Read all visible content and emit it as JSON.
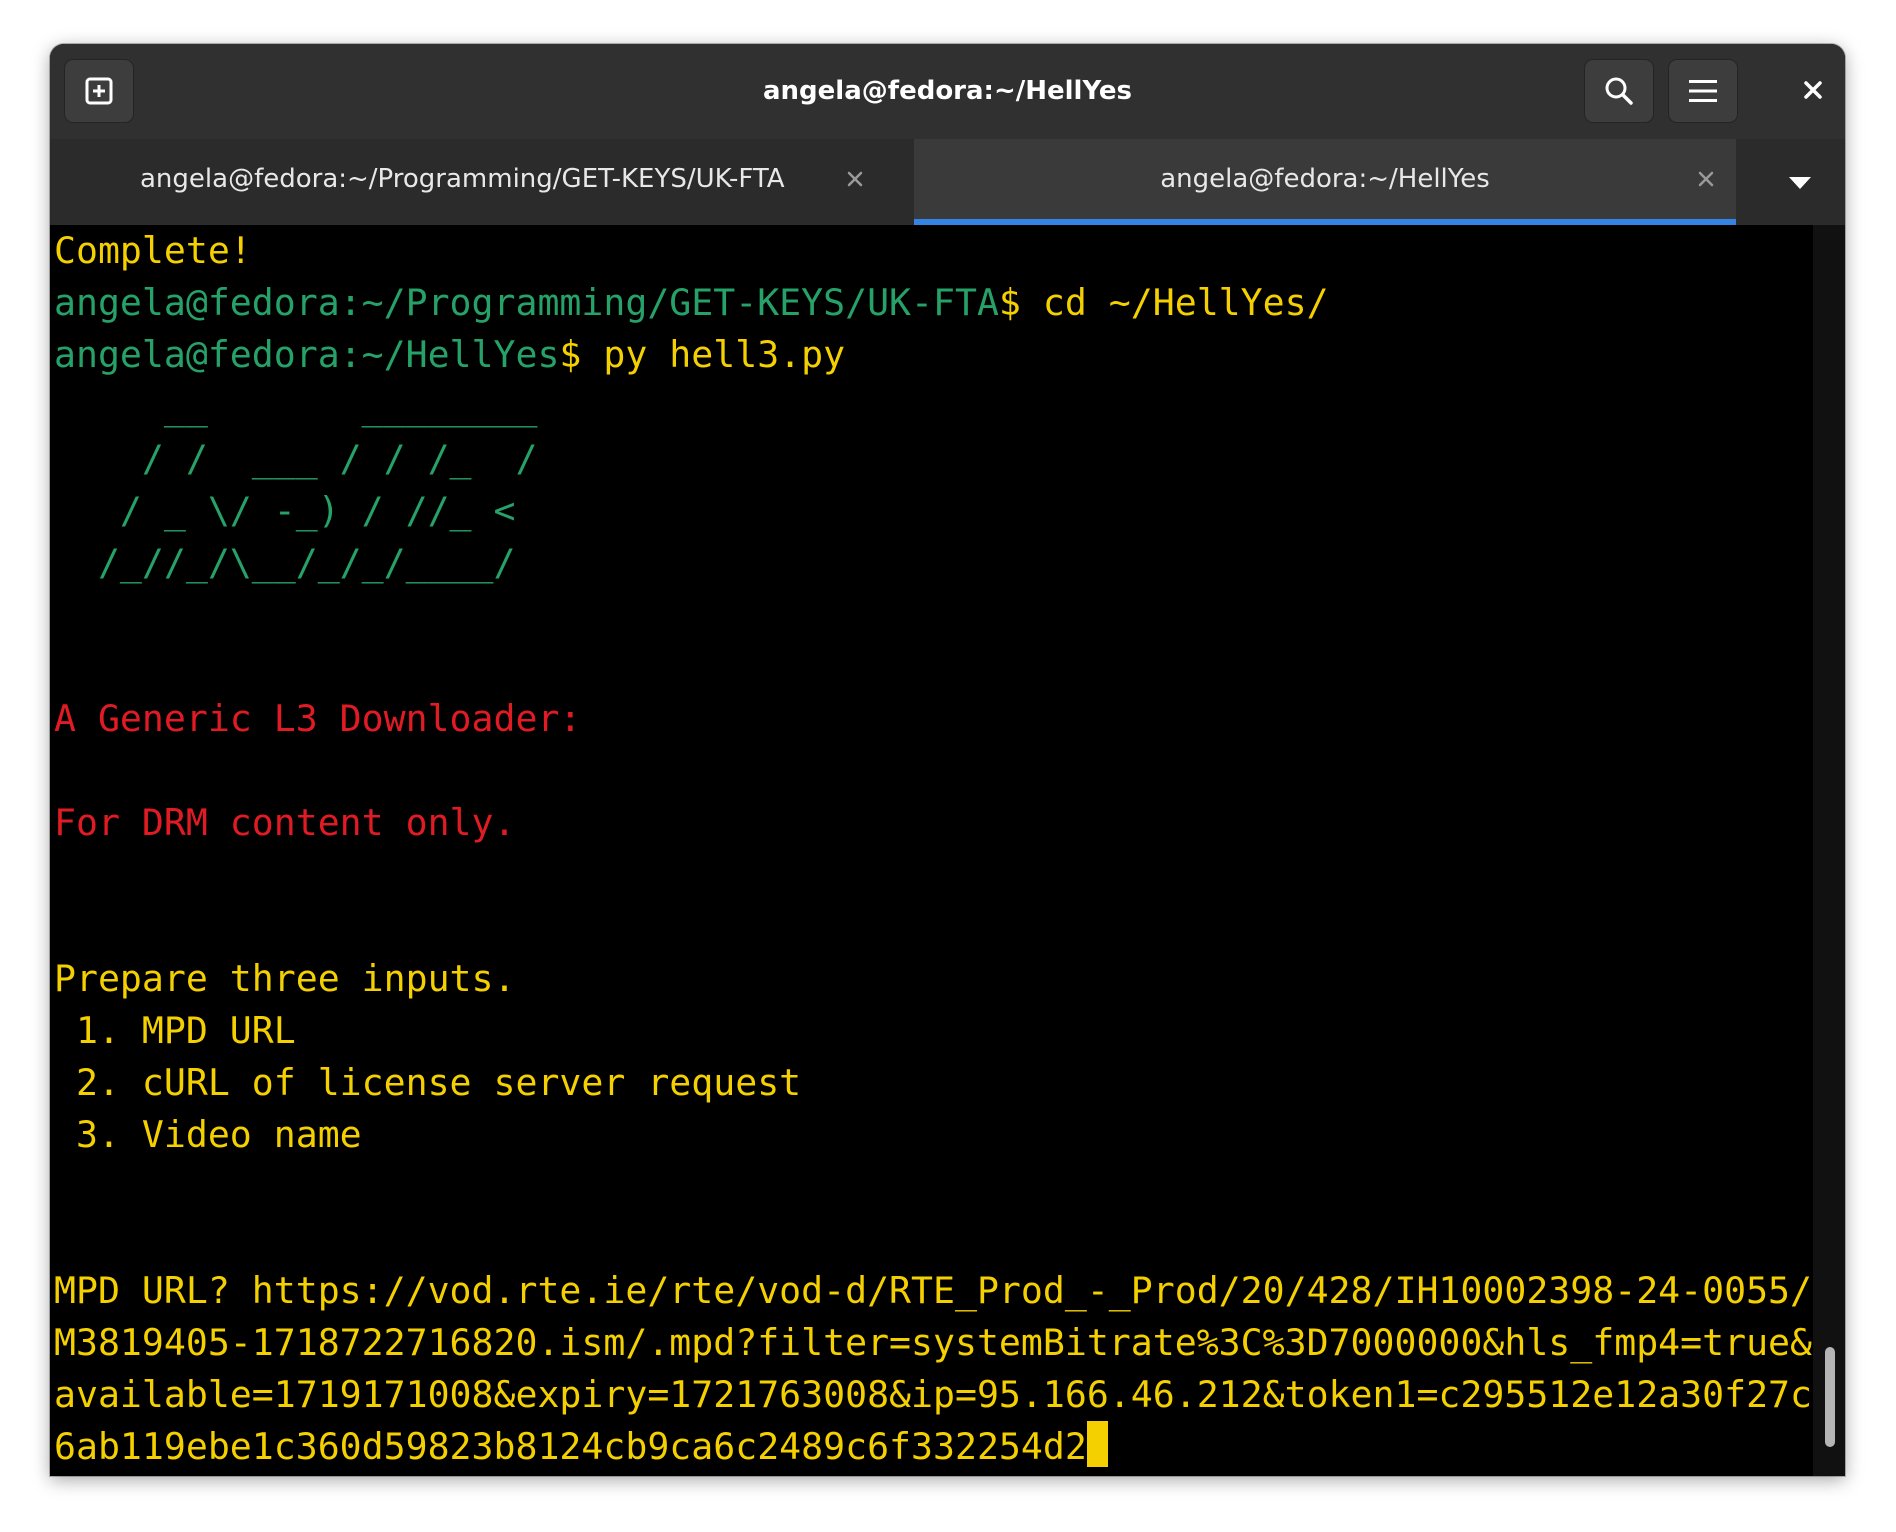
{
  "window": {
    "title": "angela@fedora:~/HellYes"
  },
  "tabs": [
    {
      "label": "angela@fedora:~/Programming/GET-KEYS/UK-FTA",
      "active": false
    },
    {
      "label": "angela@fedora:~/HellYes",
      "active": true
    }
  ],
  "icons": {
    "new_tab": "new-tab-icon",
    "search": "search-icon",
    "menu": "hamburger-menu-icon",
    "close": "close-icon",
    "tab_close": "close-icon",
    "tab_dropdown": "chevron-down-icon"
  },
  "colors": {
    "prompt_green": "#26a269",
    "text_yellow": "#f5d000",
    "text_red": "#e01b24",
    "active_tab_accent": "#3584e4"
  },
  "terminal": {
    "line1": "Complete!",
    "line2_prompt": "angela@fedora:~/Programming/GET-KEYS/UK-FTA",
    "line2_cmd": "$ cd ~/HellYes/",
    "line3_prompt": "angela@fedora:~/HellYes",
    "line3_cmd": "$ py hell3.py",
    "ascii_art": [
      "     __       ________",
      "    / /  ___ / / /_  /",
      "   / _ \\/ -_) / //_ <",
      "  /_//_/\\__/_/_/____/"
    ],
    "generic": "A Generic L3 Downloader:",
    "drm_only": "For DRM content only.",
    "prepare": "Prepare three inputs.",
    "item1": " 1. MPD URL",
    "item2": " 2. cURL of license server request",
    "item3": " 3. Video name",
    "mpd_lines": [
      "MPD URL? https://vod.rte.ie/rte/vod-d/RTE_Prod_-_Prod/20/428/IH10002398-24-0055/",
      "M3819405-1718722716820.ism/.mpd?filter=systemBitrate%3C%3D7000000&hls_fmp4=true&",
      "available=1719171008&expiry=1721763008&ip=95.166.46.212&token1=c295512e12a30f27c",
      "6ab119ebe1c360d59823b8124cb9ca6c2489c6f332254d2"
    ]
  }
}
